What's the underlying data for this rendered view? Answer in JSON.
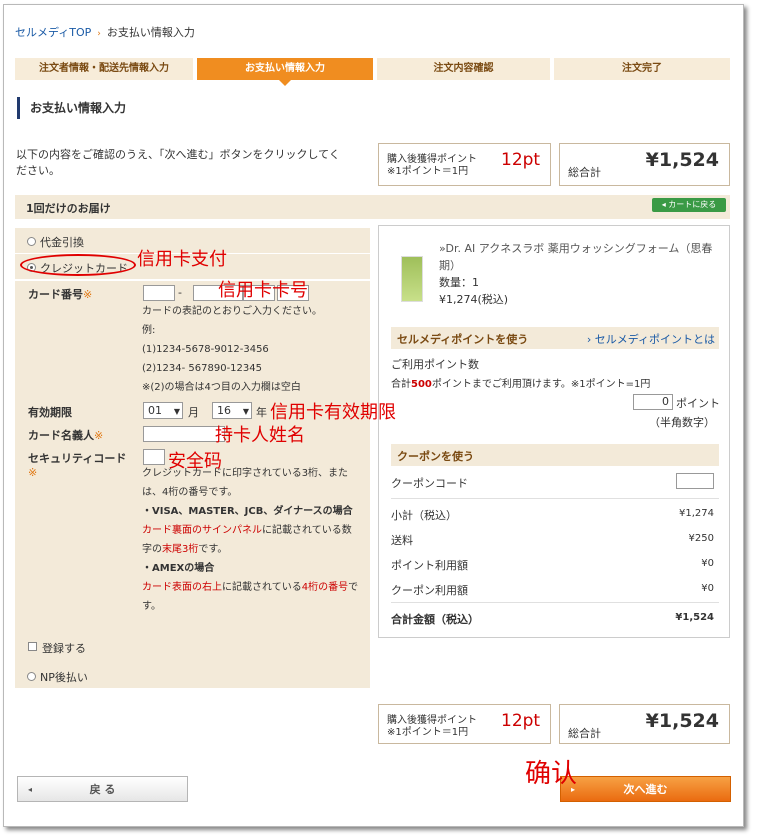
{
  "breadcrumb": {
    "home": "セルメディTOP",
    "sep": "›",
    "current": "お支払い情報入力"
  },
  "steps": [
    "注文者情報・配送先情報入力",
    "お支払い情報入力",
    "注文内容確認",
    "注文完了"
  ],
  "page_title": "お支払い情報入力",
  "intro": "以下の内容をご確認のうえ、「次へ進む」ボタンをクリックしてください。",
  "points_box": {
    "label1": "購入後獲得ポイント",
    "label2": "※1ポイント＝1円",
    "value": "12pt"
  },
  "total_box": {
    "label": "総合計",
    "value": "¥1,524"
  },
  "section_title": "1回だけのお届け",
  "back_to_cart": "◂ カートに戻る",
  "payment": {
    "cod": "代金引換",
    "credit": "クレジットカード",
    "np": "NP後払い",
    "card_number_label": "カード番号",
    "req": "※",
    "dash": "-",
    "card_help": [
      "カードの表記のとおりご入力ください。",
      "例:",
      "(1)1234-5678-9012-3456",
      "(2)1234- 567890-12345",
      "※(2)の場合は4つ目の入力欄は空白"
    ],
    "expiry_label": "有効期限",
    "month": "01",
    "month_unit": "月",
    "year": "16",
    "year_unit": "年",
    "holder_label": "カード名義人",
    "security_label": "セキュリティコード",
    "sec_help1": "クレジットカードに印字されている3桁、または、4桁の番号です。",
    "sec_help2": "・VISA、MASTER、JCB、ダイナースの場合",
    "sec_help3_red": "カード裏面のサインパネル",
    "sec_help3": "に記載されている数字の",
    "sec_help3_red2": "末尾3桁",
    "sec_help3_end": "です。",
    "sec_help4": "・AMEXの場合",
    "sec_help5_red": "カード表面の右上",
    "sec_help5": "に記載されている",
    "sec_help5_red2": "4桁の番号",
    "sec_help5_end": "です。",
    "register": "登録する"
  },
  "product": {
    "name1": "»Dr. AI アクネスラボ 薬用ウォッシングフォーム（思春",
    "name2": "期）",
    "qty": "数量：1",
    "price": "¥1,274(税込)"
  },
  "points_use": {
    "title": "セルメディポイントを使う",
    "link": "› セルメディポイントとは",
    "count_label": "ご利用ポイント数",
    "note_pre": "合計",
    "note_num": "500",
    "note_post": "ポイントまでご利用頂けます。※1ポイント=1円",
    "input_value": "0",
    "unit": "ポイント",
    "hint": "（半角数字）"
  },
  "coupon": {
    "title": "クーポンを使う",
    "label": "クーポンコード"
  },
  "summary": [
    {
      "label": "小計（税込）",
      "value": "¥1,274"
    },
    {
      "label": "送料",
      "value": "¥250"
    },
    {
      "label": "ポイント利用額",
      "value": "¥0"
    },
    {
      "label": "クーポン利用額",
      "value": "¥0"
    }
  ],
  "grand_total": {
    "label": "合計金額（税込）",
    "value": "¥1,524"
  },
  "buttons": {
    "back": "戻 る",
    "next": "次へ進む",
    "arrow": "◂",
    "arrow_next": "▸"
  },
  "annotations": {
    "credit_pay": "信用卡支付",
    "card_no": "信用卡卡号",
    "expiry": "信用卡有效期限",
    "holder": "持卡人姓名",
    "security": "安全码",
    "confirm": "确认"
  },
  "colors": {
    "accent": "#f08d20",
    "annotation": "#e00000",
    "section_bg": "#f3ead9"
  }
}
